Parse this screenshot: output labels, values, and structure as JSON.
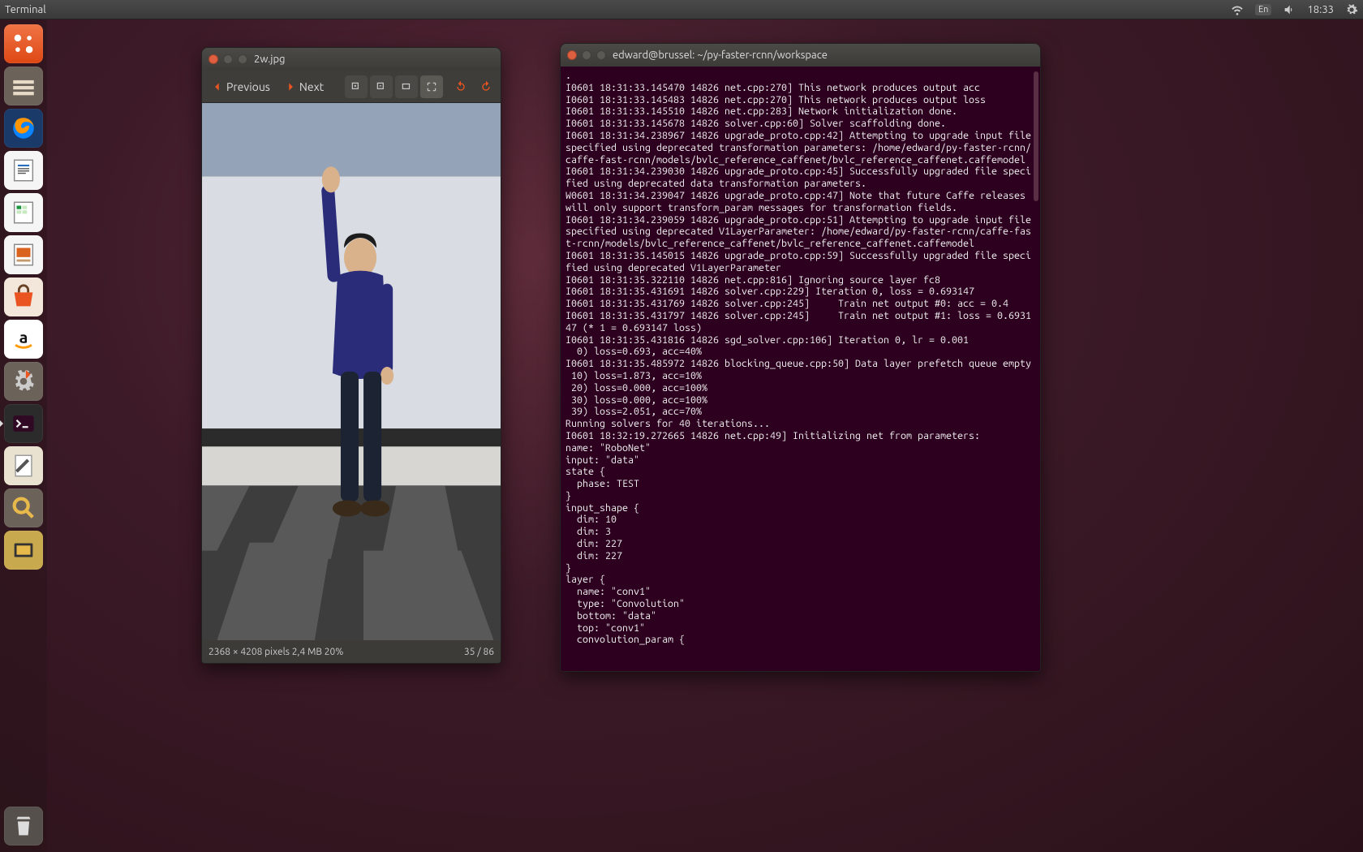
{
  "menubar": {
    "app": "Terminal",
    "lang": "En",
    "time": "18:33"
  },
  "launcher": {
    "items": [
      {
        "name": "ubuntu-dash"
      },
      {
        "name": "files"
      },
      {
        "name": "firefox"
      },
      {
        "name": "writer"
      },
      {
        "name": "calc"
      },
      {
        "name": "impress"
      },
      {
        "name": "software-center"
      },
      {
        "name": "amazon"
      },
      {
        "name": "settings"
      },
      {
        "name": "terminal"
      },
      {
        "name": "text-editor"
      },
      {
        "name": "image-viewer"
      },
      {
        "name": "disks"
      }
    ],
    "trash": "trash"
  },
  "viewer": {
    "title": "2w.jpg",
    "prev_label": "Previous",
    "next_label": "Next",
    "status_left": "2368 × 4208 pixels  2,4 MB   20%",
    "status_right": "35 / 86"
  },
  "terminal": {
    "title": "edward@brussel: ~/py-faster-rcnn/workspace",
    "lines": [
      ".",
      "I0601 18:31:33.145470 14826 net.cpp:270] This network produces output acc",
      "I0601 18:31:33.145483 14826 net.cpp:270] This network produces output loss",
      "I0601 18:31:33.145510 14826 net.cpp:283] Network initialization done.",
      "I0601 18:31:33.145678 14826 solver.cpp:60] Solver scaffolding done.",
      "I0601 18:31:34.238967 14826 upgrade_proto.cpp:42] Attempting to upgrade input file specified using deprecated transformation parameters: /home/edward/py-faster-rcnn/caffe-fast-rcnn/models/bvlc_reference_caffenet/bvlc_reference_caffenet.caffemodel",
      "I0601 18:31:34.239030 14826 upgrade_proto.cpp:45] Successfully upgraded file specified using deprecated data transformation parameters.",
      "W0601 18:31:34.239047 14826 upgrade_proto.cpp:47] Note that future Caffe releases will only support transform_param messages for transformation fields.",
      "I0601 18:31:34.239059 14826 upgrade_proto.cpp:51] Attempting to upgrade input file specified using deprecated V1LayerParameter: /home/edward/py-faster-rcnn/caffe-fast-rcnn/models/bvlc_reference_caffenet/bvlc_reference_caffenet.caffemodel",
      "I0601 18:31:35.145015 14826 upgrade_proto.cpp:59] Successfully upgraded file specified using deprecated V1LayerParameter",
      "I0601 18:31:35.322110 14826 net.cpp:816] Ignoring source layer fc8",
      "I0601 18:31:35.431691 14826 solver.cpp:229] Iteration 0, loss = 0.693147",
      "I0601 18:31:35.431769 14826 solver.cpp:245]     Train net output #0: acc = 0.4",
      "I0601 18:31:35.431797 14826 solver.cpp:245]     Train net output #1: loss = 0.693147 (* 1 = 0.693147 loss)",
      "I0601 18:31:35.431816 14826 sgd_solver.cpp:106] Iteration 0, lr = 0.001",
      "  0) loss=0.693, acc=40%",
      "I0601 18:31:35.485972 14826 blocking_queue.cpp:50] Data layer prefetch queue empty",
      " 10) loss=1.873, acc=10%",
      " 20) loss=0.000, acc=100%",
      " 30) loss=0.000, acc=100%",
      " 39) loss=2.051, acc=70%",
      "Running solvers for 40 iterations...",
      "I0601 18:32:19.272665 14826 net.cpp:49] Initializing net from parameters:",
      "name: \"RoboNet\"",
      "input: \"data\"",
      "state {",
      "  phase: TEST",
      "}",
      "input_shape {",
      "  dim: 10",
      "  dim: 3",
      "  dim: 227",
      "  dim: 227",
      "}",
      "layer {",
      "  name: \"conv1\"",
      "  type: \"Convolution\"",
      "  bottom: \"data\"",
      "  top: \"conv1\"",
      "  convolution_param {"
    ]
  }
}
